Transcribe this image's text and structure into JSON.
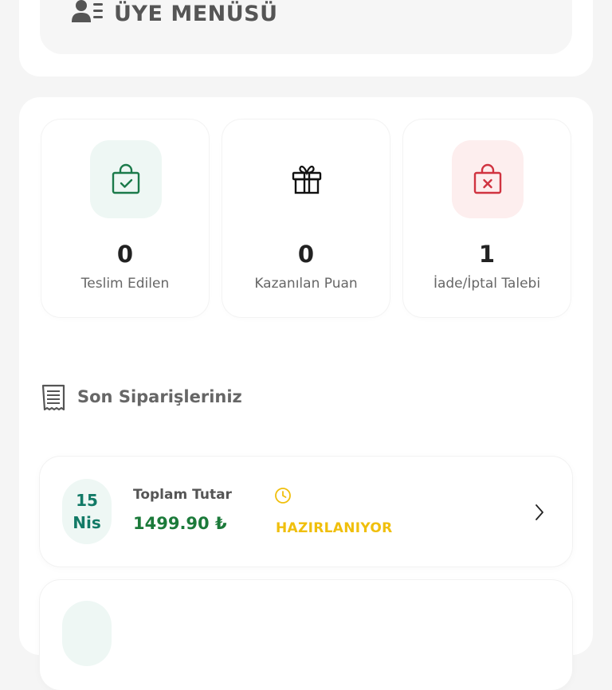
{
  "member_menu": {
    "title": "ÜYE MENÜSÜ",
    "icon": "user-list-icon"
  },
  "stats": [
    {
      "count": "0",
      "label": "Teslim Edilen",
      "icon": "shopping-bag-check-icon",
      "bg": "#eef7f4",
      "color": "#1b7a4a"
    },
    {
      "count": "0",
      "label": "Kazanılan Puan",
      "icon": "gift-icon",
      "bg": "#ffffff",
      "color": "#111111"
    },
    {
      "count": "1",
      "label": "İade/İptal Talebi",
      "icon": "shopping-bag-x-icon",
      "bg": "#fdeeee",
      "color": "#d03340"
    }
  ],
  "orders_section": {
    "title": "Son Siparişleriniz",
    "icon": "receipt-icon"
  },
  "orders": [
    {
      "day": "15",
      "month": "Nis",
      "total_label": "Toplam Tutar",
      "total_value": "1499.90 ₺",
      "status": "HAZIRLANIYOR",
      "status_color": "#f0bf0c",
      "status_icon": "clock-icon"
    }
  ]
}
